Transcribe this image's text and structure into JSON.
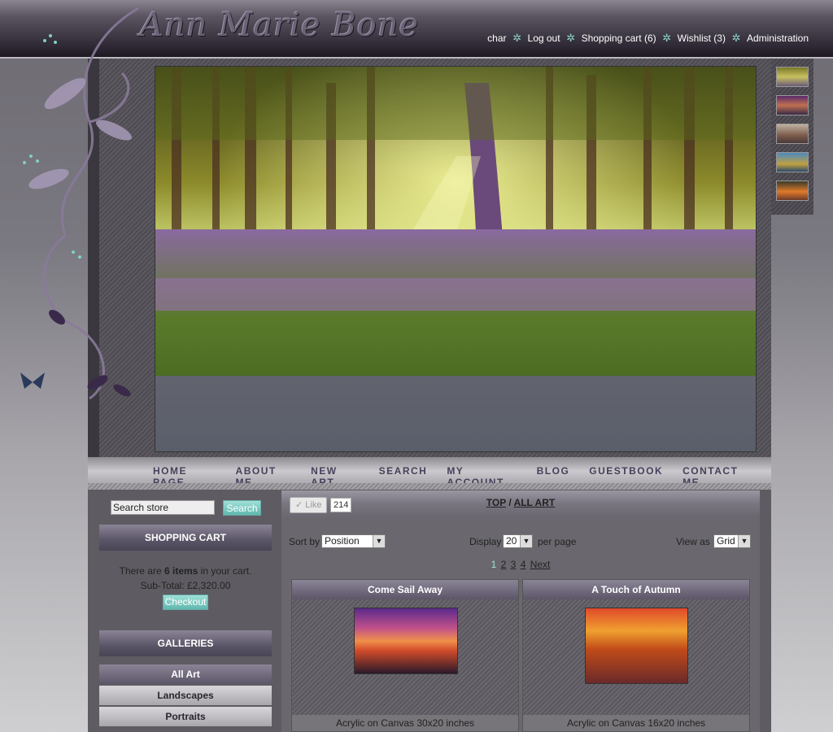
{
  "header": {
    "logo": "Ann Marie Bone",
    "user": "char",
    "links": [
      "Log out",
      "Shopping cart (6)",
      "Wishlist (3)",
      "Administration"
    ]
  },
  "nav": [
    "HOME PAGE",
    "ABOUT ME",
    "NEW ART",
    "SEARCH",
    "MY ACCOUNT",
    "BLOG",
    "GUESTBOOK",
    "CONTACT ME"
  ],
  "sidebar": {
    "search_value": "Search store",
    "search_button": "Search",
    "cart_heading": "SHOPPING CART",
    "cart_text_pre": "There are ",
    "cart_items": "6 items",
    "cart_text_post": " in your cart.",
    "subtotal": "Sub-Total: £2,320.00",
    "checkout": "Checkout",
    "galleries_heading": "GALLERIES",
    "galleries": [
      "All Art",
      "Landscapes",
      "Portraits"
    ]
  },
  "content": {
    "like_label": "Like",
    "like_count": "214",
    "breadcrumb_top": "TOP",
    "breadcrumb_sep": "/",
    "breadcrumb_current": "ALL ART",
    "sort_label": "Sort by",
    "sort_value": "Position",
    "display_label": "Display",
    "display_value": "20",
    "per_page": "per page",
    "view_label": "View as",
    "view_value": "Grid",
    "pages": [
      "1",
      "2",
      "3",
      "4",
      "Next"
    ],
    "products": [
      {
        "title": "Come Sail Away",
        "desc": "Acrylic on Canvas 30x20 inches"
      },
      {
        "title": "A Touch of Autumn",
        "desc": "Acrylic on Canvas 16x20 inches"
      }
    ]
  },
  "colors": {
    "accent": "#5fb8ad",
    "header_bg": "#2a2530",
    "frame": "#5e5c62"
  }
}
